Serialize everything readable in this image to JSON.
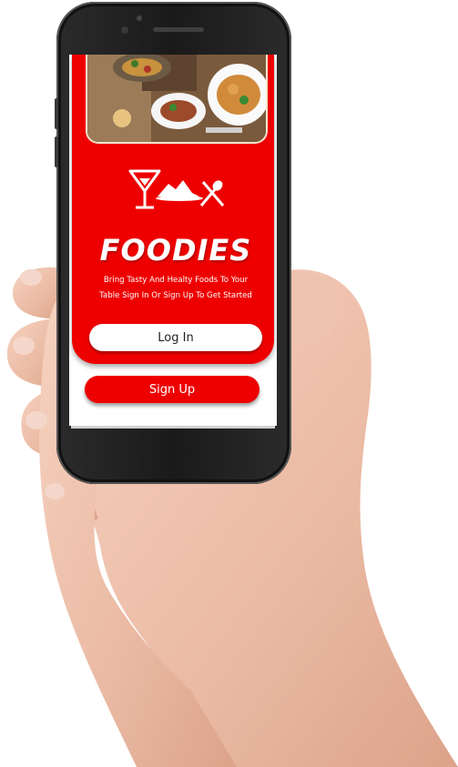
{
  "app": {
    "brand_name": "FOODIES",
    "tagline_line1": "Bring Tasty And Healty Foods To Your",
    "tagline_line2": "Table Sign In  Or Sign Up To Get Started"
  },
  "buttons": {
    "login_label": "Log In",
    "signup_label": "Sign Up"
  },
  "icons": {
    "logo": "cocktail-glass-food-plate-spoon-fork-icon",
    "header_image": "restaurant-dishes-photo"
  },
  "colors": {
    "accent": "#ee0000",
    "button_light": "#ffffff",
    "text_on_accent": "#ffffff",
    "phone_body": "#1a1a1a"
  }
}
